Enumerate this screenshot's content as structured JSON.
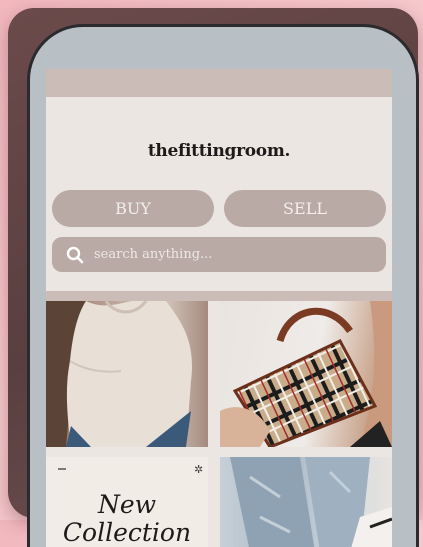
{
  "app": {
    "logo_text": "thefittingroom."
  },
  "actions": {
    "buy_label": "BUY",
    "sell_label": "SELL"
  },
  "search": {
    "placeholder": "search anything...",
    "value": ""
  },
  "tiles": [
    {
      "name": "white-top"
    },
    {
      "name": "plaid-handbag"
    },
    {
      "name": "new-collection",
      "text": "New\nCollection"
    },
    {
      "name": "denim-jeans"
    }
  ],
  "colors": {
    "background": "#f4c3c8",
    "card": "#5e4243",
    "screen": "#ebe6e2",
    "pill": "#b9aaa5",
    "accent_bar": "#cbbcb7"
  },
  "icons": {
    "search": "search-icon"
  }
}
